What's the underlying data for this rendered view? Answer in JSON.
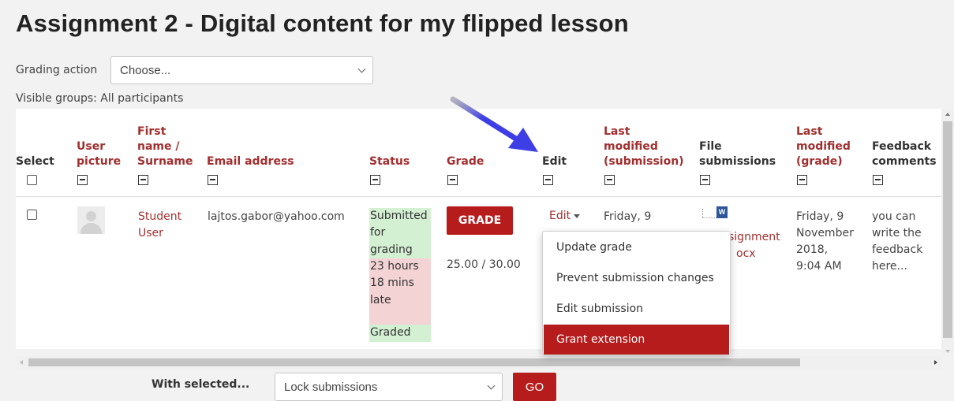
{
  "page": {
    "title": "Assignment 2 - Digital content for my flipped lesson"
  },
  "toolbar": {
    "grading_action_label": "Grading action",
    "grading_action_value": "Choose...",
    "visible_groups": "Visible groups: All participants"
  },
  "table": {
    "headers": {
      "select": "Select",
      "user_picture": [
        "User",
        "picture"
      ],
      "name": [
        "First",
        "name /",
        "Surname"
      ],
      "email": "Email address",
      "status": "Status",
      "grade": "Grade",
      "edit": "Edit",
      "last_modified_submission": [
        "Last",
        "modified",
        "(submission)"
      ],
      "file_submissions": [
        "File",
        "submissions"
      ],
      "last_modified_grade": [
        "Last",
        "modified",
        "(grade)"
      ],
      "feedback": [
        "Feedback",
        "comments"
      ]
    },
    "row": {
      "name": [
        "Student",
        "User"
      ],
      "email": "lajtos.gabor@yahoo.com",
      "status_submitted": [
        "Submitted",
        "for",
        "grading"
      ],
      "status_late": [
        "23 hours",
        "18 mins",
        "late"
      ],
      "status_graded": "Graded",
      "grade_button": "GRADE",
      "grade_value": "25.00 / 30.00",
      "edit_label": "Edit",
      "last_modified_submission": "Friday, 9",
      "file_name": [
        "signment",
        "ocx"
      ],
      "last_modified_grade": [
        "Friday, 9",
        "November",
        "2018,",
        "9:04 AM"
      ],
      "feedback": [
        "you can",
        "write the",
        "feedback",
        "here..."
      ]
    }
  },
  "edit_menu": {
    "items": [
      "Update grade",
      "Prevent submission changes",
      "Edit submission",
      "Grant extension"
    ],
    "active_index": 3
  },
  "bulk": {
    "with_selected_label": "With selected...",
    "action_value": "Lock submissions",
    "go_label": "GO"
  },
  "colors": {
    "accent": "#b71c1c",
    "link": "#a22f2f",
    "status_green": "#d4f0d2",
    "status_red": "#f4d3d4",
    "annotation_arrow": "#3e3ee6"
  }
}
